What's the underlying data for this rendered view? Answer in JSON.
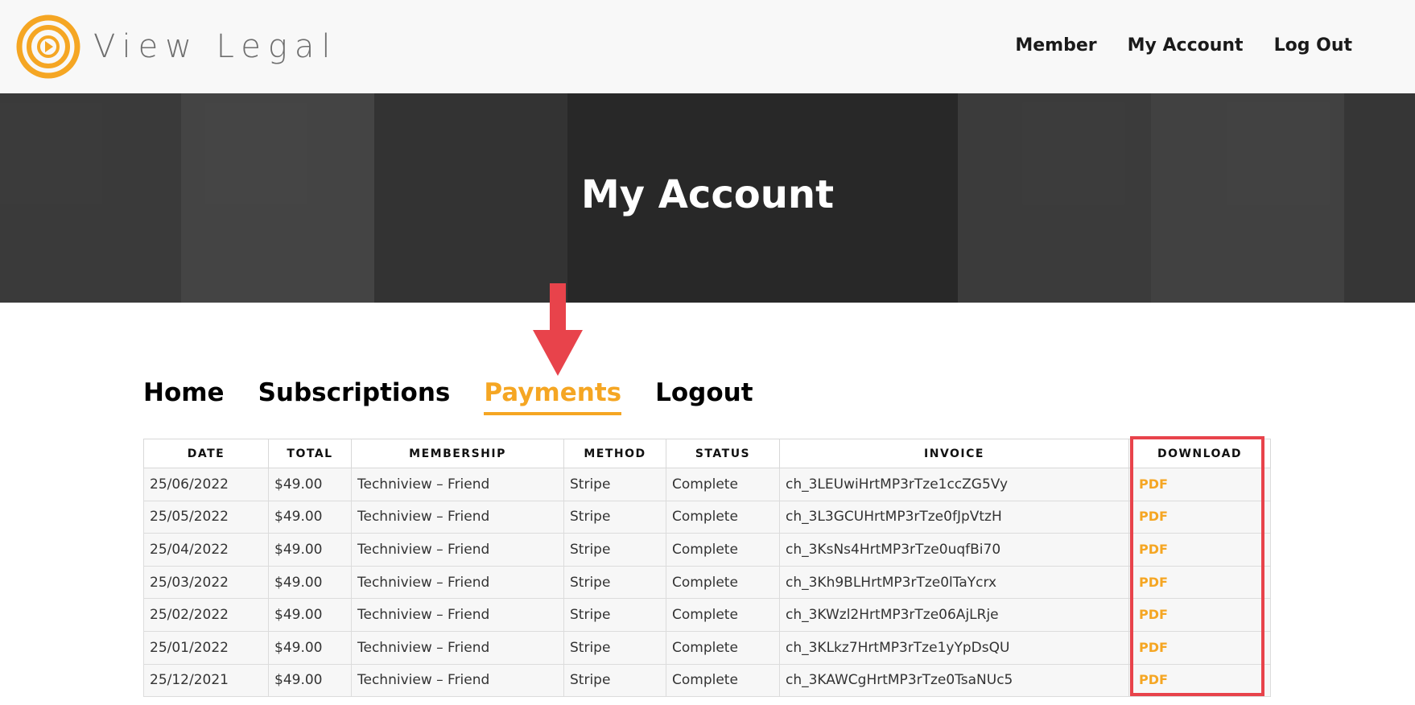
{
  "header": {
    "logo_text": "View Legal",
    "nav": [
      "Member",
      "My Account",
      "Log Out"
    ]
  },
  "hero": {
    "title": "My Account"
  },
  "tabs": [
    {
      "label": "Home",
      "active": false
    },
    {
      "label": "Subscriptions",
      "active": false
    },
    {
      "label": "Payments",
      "active": true
    },
    {
      "label": "Logout",
      "active": false
    }
  ],
  "table": {
    "headers": [
      "DATE",
      "TOTAL",
      "MEMBERSHIP",
      "METHOD",
      "STATUS",
      "INVOICE",
      "DOWNLOAD"
    ],
    "rows": [
      [
        "25/06/2022",
        "$49.00",
        "Techniview – Friend",
        "Stripe",
        "Complete",
        "ch_3LEUwiHrtMP3rTze1ccZG5Vy",
        "PDF"
      ],
      [
        "25/05/2022",
        "$49.00",
        "Techniview – Friend",
        "Stripe",
        "Complete",
        "ch_3L3GCUHrtMP3rTze0fJpVtzH",
        "PDF"
      ],
      [
        "25/04/2022",
        "$49.00",
        "Techniview – Friend",
        "Stripe",
        "Complete",
        "ch_3KsNs4HrtMP3rTze0uqfBi70",
        "PDF"
      ],
      [
        "25/03/2022",
        "$49.00",
        "Techniview – Friend",
        "Stripe",
        "Complete",
        "ch_3Kh9BLHrtMP3rTze0lTaYcrx",
        "PDF"
      ],
      [
        "25/02/2022",
        "$49.00",
        "Techniview – Friend",
        "Stripe",
        "Complete",
        "ch_3KWzl2HrtMP3rTze06AjLRje",
        "PDF"
      ],
      [
        "25/01/2022",
        "$49.00",
        "Techniview – Friend",
        "Stripe",
        "Complete",
        "ch_3KLkz7HrtMP3rTze1yYpDsQU",
        "PDF"
      ],
      [
        "25/12/2021",
        "$49.00",
        "Techniview – Friend",
        "Stripe",
        "Complete",
        "ch_3KAWCgHrtMP3rTze0TsaNUc5",
        "PDF"
      ]
    ]
  },
  "colors": {
    "accent": "#f5a623",
    "annotation": "#e8434b"
  },
  "icons": {
    "logo": "spiral-play-logo-icon",
    "annotation_arrow": "down-arrow-icon"
  }
}
